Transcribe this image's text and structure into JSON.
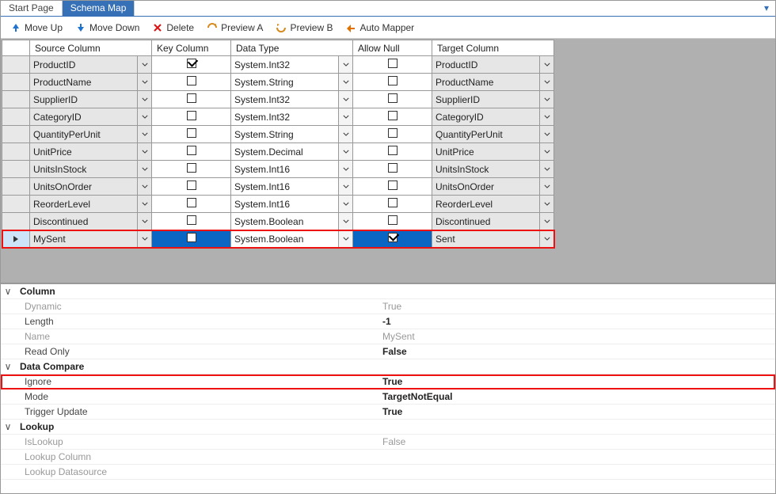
{
  "tabs": {
    "start": "Start Page",
    "schema": "Schema Map"
  },
  "toolbar": {
    "moveUp": "Move Up",
    "moveDown": "Move Down",
    "delete": "Delete",
    "previewA": "Preview A",
    "previewB": "Preview B",
    "autoMapper": "Auto Mapper"
  },
  "headers": {
    "source": "Source Column",
    "key": "Key Column",
    "type": "Data Type",
    "null": "Allow Null",
    "target": "Target Column"
  },
  "rows": [
    {
      "source": "ProductID",
      "key": true,
      "type": "System.Int32",
      "null": false,
      "target": "ProductID"
    },
    {
      "source": "ProductName",
      "key": false,
      "type": "System.String",
      "null": false,
      "target": "ProductName"
    },
    {
      "source": "SupplierID",
      "key": false,
      "type": "System.Int32",
      "null": false,
      "target": "SupplierID"
    },
    {
      "source": "CategoryID",
      "key": false,
      "type": "System.Int32",
      "null": false,
      "target": "CategoryID"
    },
    {
      "source": "QuantityPerUnit",
      "key": false,
      "type": "System.String",
      "null": false,
      "target": "QuantityPerUnit"
    },
    {
      "source": "UnitPrice",
      "key": false,
      "type": "System.Decimal",
      "null": false,
      "target": "UnitPrice"
    },
    {
      "source": "UnitsInStock",
      "key": false,
      "type": "System.Int16",
      "null": false,
      "target": "UnitsInStock"
    },
    {
      "source": "UnitsOnOrder",
      "key": false,
      "type": "System.Int16",
      "null": false,
      "target": "UnitsOnOrder"
    },
    {
      "source": "ReorderLevel",
      "key": false,
      "type": "System.Int16",
      "null": false,
      "target": "ReorderLevel"
    },
    {
      "source": "Discontinued",
      "key": false,
      "type": "System.Boolean",
      "null": false,
      "target": "Discontinued"
    },
    {
      "source": "MySent",
      "key": false,
      "type": "System.Boolean",
      "null": true,
      "target": "Sent",
      "selected": true
    }
  ],
  "props": {
    "column": {
      "cat": "Column",
      "dynamic": {
        "l": "Dynamic",
        "v": "True"
      },
      "length": {
        "l": "Length",
        "v": "-1"
      },
      "name": {
        "l": "Name",
        "v": "MySent"
      },
      "readonly": {
        "l": "Read Only",
        "v": "False"
      }
    },
    "compare": {
      "cat": "Data Compare",
      "ignore": {
        "l": "Ignore",
        "v": "True"
      },
      "mode": {
        "l": "Mode",
        "v": "TargetNotEqual"
      },
      "trigger": {
        "l": "Trigger Update",
        "v": "True"
      }
    },
    "lookup": {
      "cat": "Lookup",
      "islookup": {
        "l": "IsLookup",
        "v": "False"
      },
      "col": {
        "l": "Lookup Column",
        "v": ""
      },
      "ds": {
        "l": "Lookup Datasource",
        "v": ""
      }
    }
  }
}
